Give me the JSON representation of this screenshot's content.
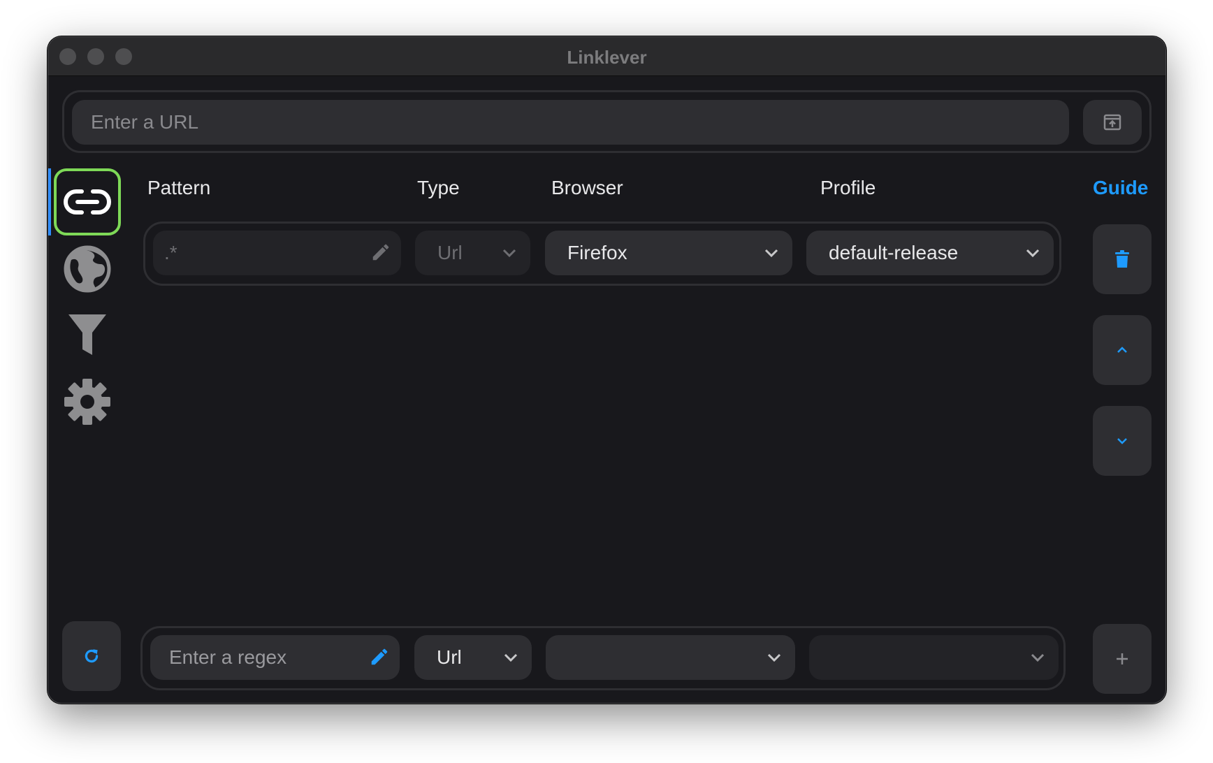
{
  "window": {
    "title": "Linklever"
  },
  "url_bar": {
    "placeholder": "Enter a URL",
    "open_button_icon": "open-in-app-icon"
  },
  "sidebar": {
    "items": [
      {
        "name": "rules",
        "icon": "link-icon",
        "active": true
      },
      {
        "name": "browsers",
        "icon": "globe-icon",
        "active": false
      },
      {
        "name": "filters",
        "icon": "filter-icon",
        "active": false
      },
      {
        "name": "settings",
        "icon": "gear-icon",
        "active": false
      }
    ],
    "refresh_icon": "refresh-icon"
  },
  "table": {
    "headers": {
      "pattern": "Pattern",
      "type": "Type",
      "browser": "Browser",
      "profile": "Profile"
    },
    "guide_label": "Guide",
    "rows": [
      {
        "pattern": ".*",
        "type": "Url",
        "browser": "Firefox",
        "profile": "default-release"
      }
    ]
  },
  "new_rule": {
    "pattern_placeholder": "Enter a regex",
    "type": "Url",
    "browser": "",
    "profile": ""
  },
  "colors": {
    "accent": "#1e9bff",
    "active_outline": "#7ed957",
    "background": "#18181c",
    "control": "#2e2e32"
  }
}
